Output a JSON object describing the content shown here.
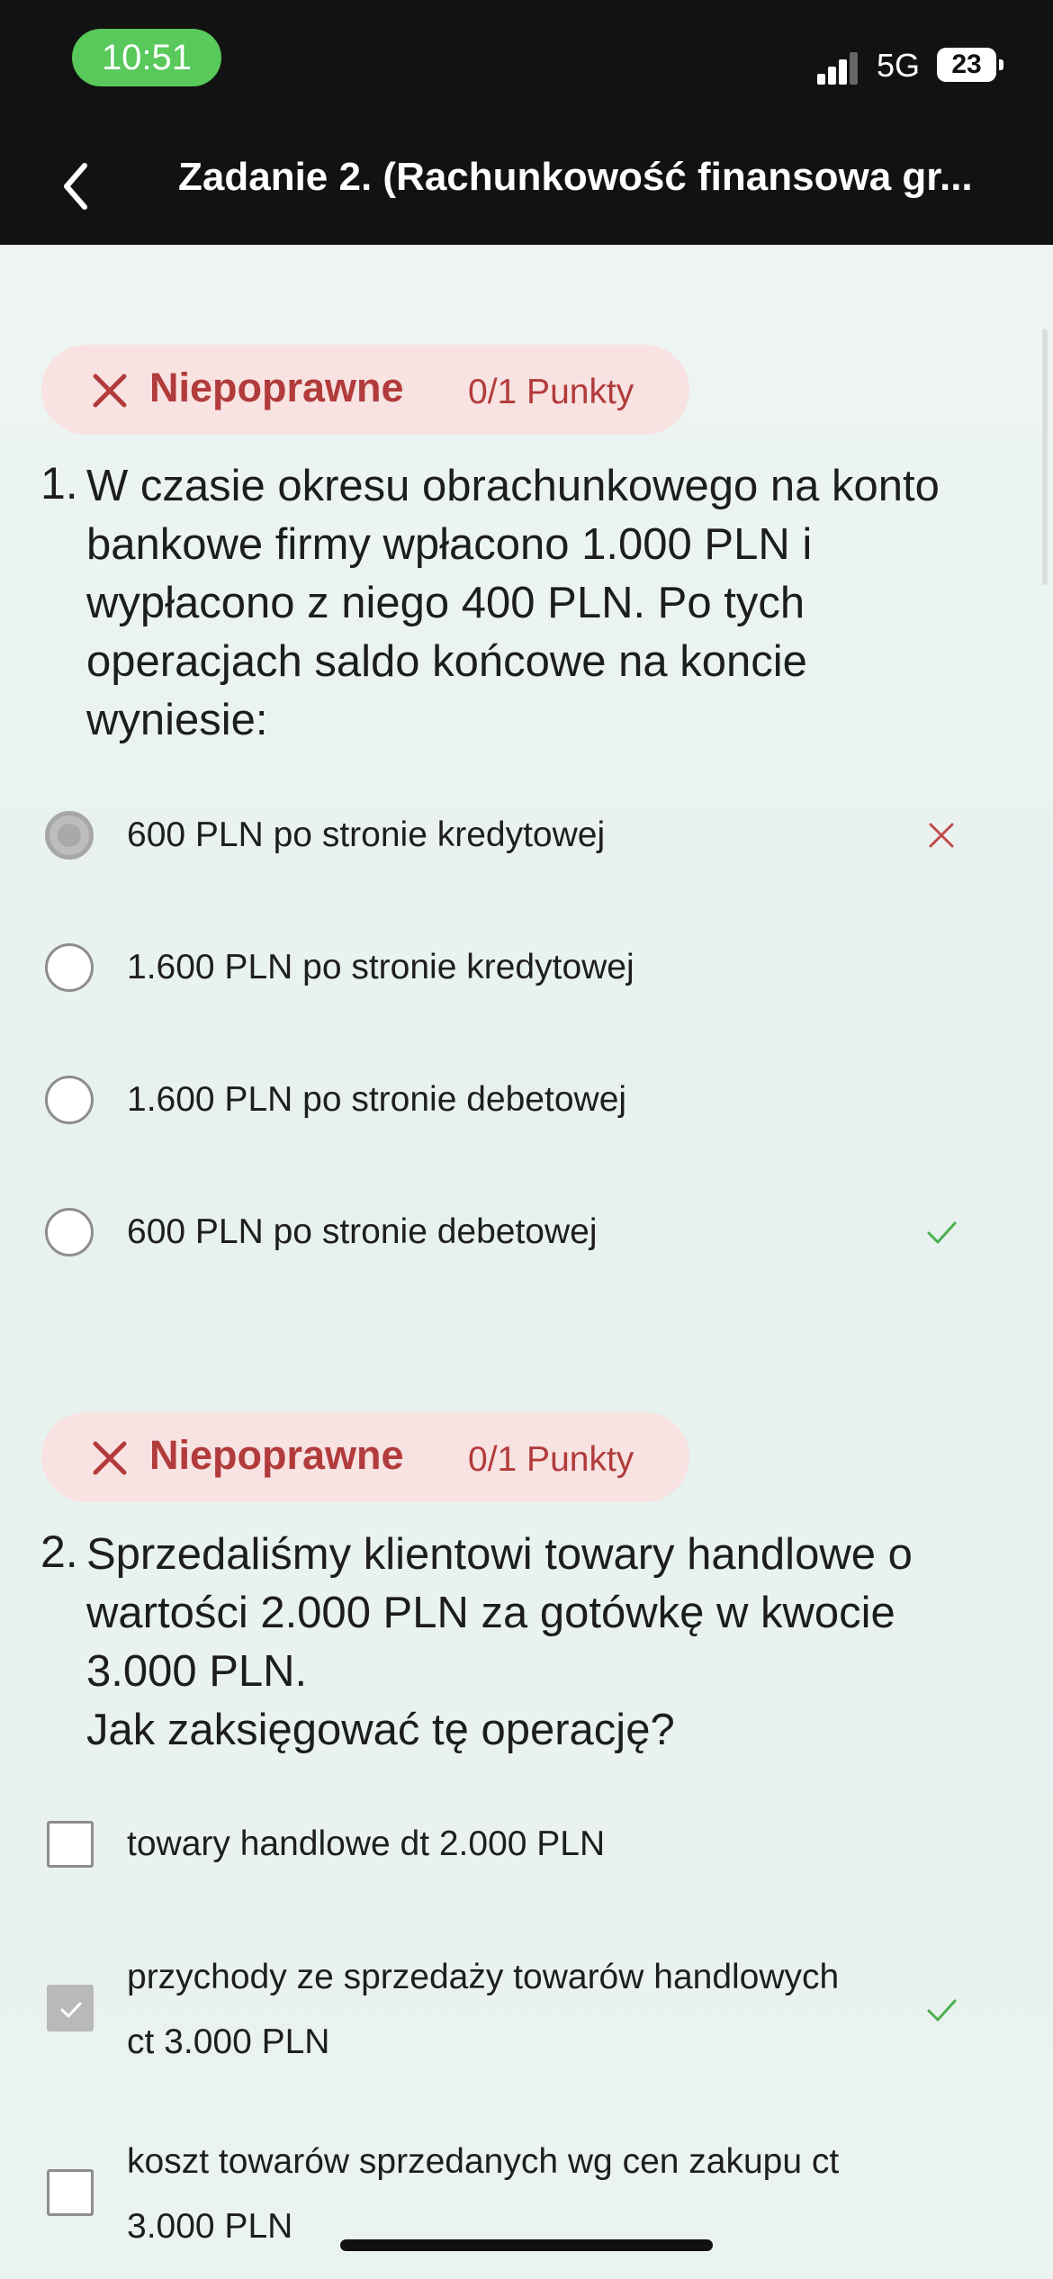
{
  "status_bar": {
    "time": "10:51",
    "network": "5G",
    "battery": "23"
  },
  "nav": {
    "title": "Zadanie 2. (Rachunkowość finansowa gr..."
  },
  "questions": [
    {
      "status": "Niepoprawne",
      "points": "0/1 Punkty",
      "number": "1.",
      "lines": [
        "W czasie okresu obrachunkowego na konto",
        "bankowe firmy wpłacono 1.000 PLN i",
        "wypłacono z niego 400 PLN. Po tych",
        "operacjach saldo końcowe na koncie",
        "wyniesie:"
      ],
      "options": [
        {
          "text": "600 PLN po stronie kredytowej",
          "selected": true,
          "mark": "wrong"
        },
        {
          "text": "1.600 PLN po stronie kredytowej",
          "selected": false,
          "mark": ""
        },
        {
          "text": "1.600 PLN po stronie debetowej",
          "selected": false,
          "mark": ""
        },
        {
          "text": "600 PLN po stronie debetowej",
          "selected": false,
          "mark": "correct"
        }
      ]
    },
    {
      "status": "Niepoprawne",
      "points": "0/1 Punkty",
      "number": "2.",
      "lines": [
        "Sprzedaliśmy klientowi towary handlowe o",
        "wartości 2.000 PLN za gotówkę w kwocie",
        "3.000 PLN.",
        "Jak zaksięgować tę operację?"
      ],
      "options": [
        {
          "lines": [
            "towary handlowe dt 2.000 PLN"
          ],
          "selected": false,
          "mark": ""
        },
        {
          "lines": [
            "przychody ze sprzedaży towarów handlowych",
            "ct 3.000 PLN"
          ],
          "selected": true,
          "mark": "correct"
        },
        {
          "lines": [
            "koszt towarów sprzedanych wg cen zakupu ct",
            "3.000 PLN"
          ],
          "selected": false,
          "mark": ""
        }
      ]
    }
  ],
  "colors": {
    "accent_red": "#b23b3b",
    "correct_green": "#4caf50",
    "badge_bg": "#f8e2e2"
  }
}
